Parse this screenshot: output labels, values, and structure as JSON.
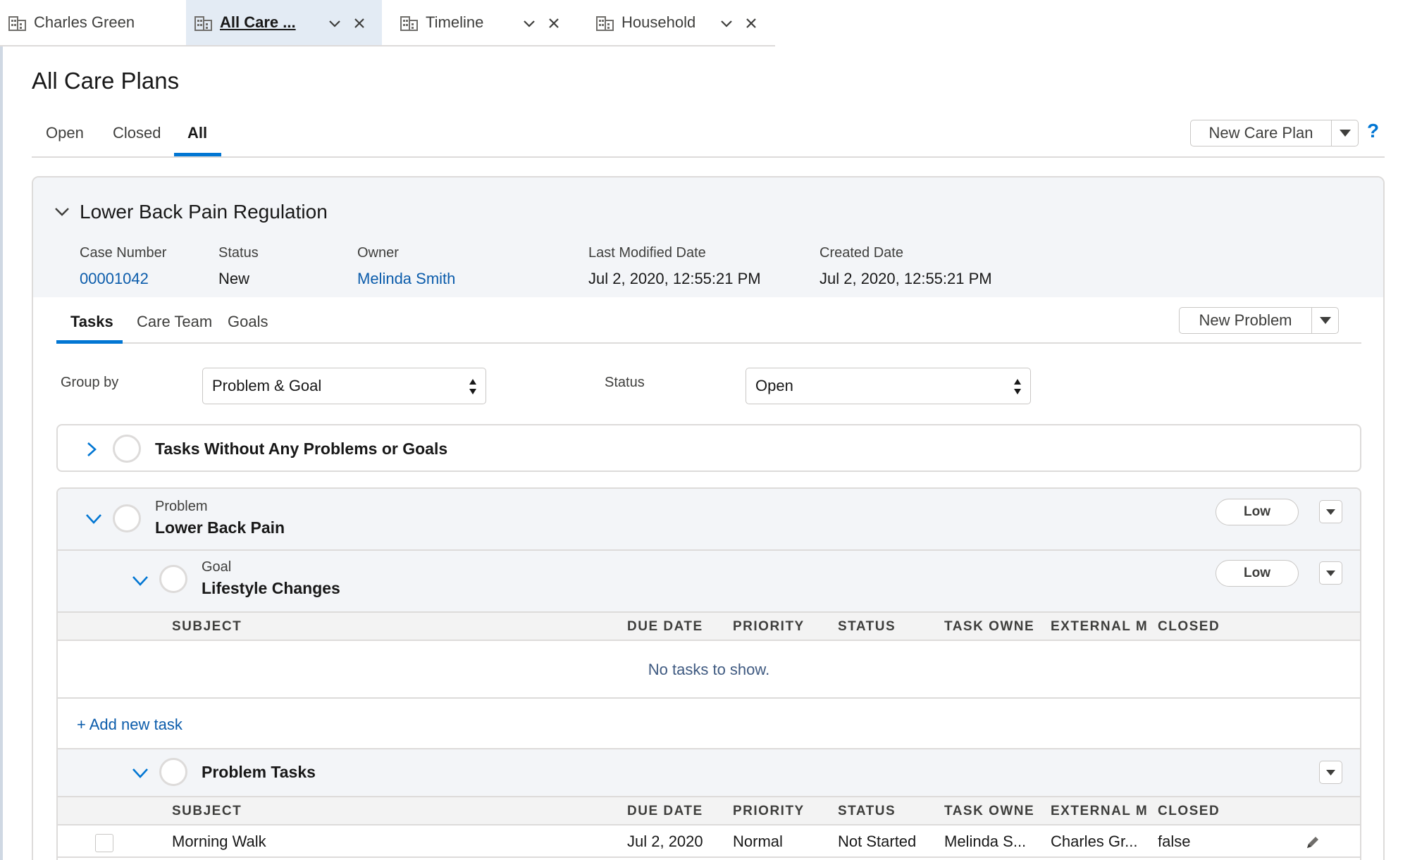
{
  "workspace_tabs": [
    {
      "label": "Charles Green"
    },
    {
      "label": "All Care ..."
    },
    {
      "label": "Timeline"
    },
    {
      "label": "Household"
    }
  ],
  "page": {
    "title": "All Care Plans",
    "tabs": [
      "Open",
      "Closed",
      "All"
    ],
    "active_tab": "All",
    "new_button": "New Care Plan",
    "help": "?"
  },
  "care_plan": {
    "title": "Lower Back Pain Regulation",
    "fields": [
      {
        "label": "Case Number",
        "value": "00001042"
      },
      {
        "label": "Status",
        "value": "New"
      },
      {
        "label": "Owner",
        "value": "Melinda Smith"
      },
      {
        "label": "Last Modified Date",
        "value": "Jul 2, 2020, 12:55:21 PM"
      },
      {
        "label": "Created Date",
        "value": "Jul 2, 2020, 12:55:21 PM"
      }
    ],
    "tabs": [
      "Tasks",
      "Care Team",
      "Goals"
    ],
    "new_problem_button": "New Problem"
  },
  "filters": {
    "group_by_label": "Group by",
    "group_by_value": "Problem & Goal",
    "status_label": "Status",
    "status_value": "Open"
  },
  "groups": {
    "no_problems": "Tasks Without Any Problems or Goals",
    "problem": {
      "type": "Problem",
      "name": "Lower Back Pain",
      "priority": "Low"
    },
    "goal": {
      "type": "Goal",
      "name": "Lifestyle Changes",
      "priority": "Low"
    },
    "problem_tasks": "Problem Tasks"
  },
  "table": {
    "columns": [
      "SUBJECT",
      "DUE DATE",
      "PRIORITY",
      "STATUS",
      "TASK OWNER",
      "EXTERNAL M",
      "CLOSED"
    ],
    "empty_message": "No tasks to show.",
    "add_task": "+ Add new task",
    "rows": [
      {
        "subject": "Morning Walk",
        "due": "Jul 2, 2020",
        "priority": "Normal",
        "status": "Not Started",
        "owner": "Melinda S...",
        "external": "Charles Gr...",
        "closed": "false"
      }
    ]
  },
  "colors": {
    "accent": "#0176d3",
    "link": "#0b5cab",
    "shade": "#f3f5f8",
    "active_tab_bg": "#e3ebf4"
  },
  "icons": [
    "building-icon",
    "chevron-down-icon",
    "close-icon",
    "chevron-right-icon",
    "sort-arrows-icon",
    "pencil-icon",
    "dropdown-triangle-icon"
  ]
}
